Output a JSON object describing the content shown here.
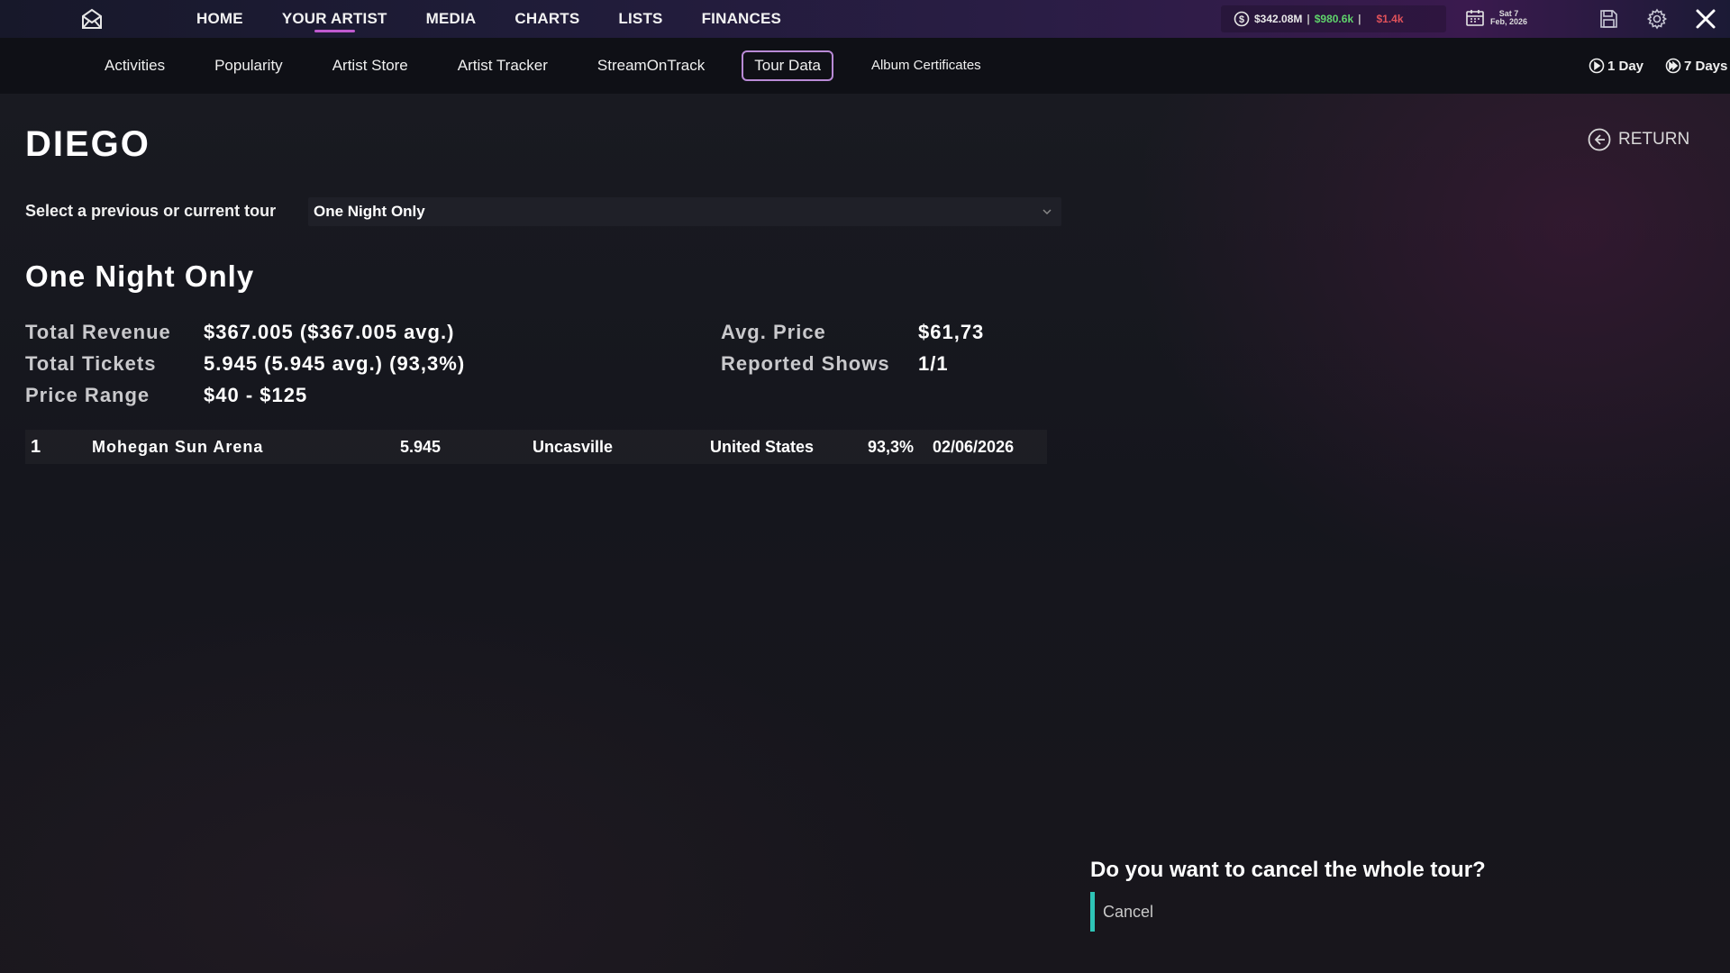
{
  "topnav": {
    "items": [
      "HOME",
      "YOUR ARTIST",
      "MEDIA",
      "CHARTS",
      "LISTS",
      "FINANCES"
    ],
    "active_index": 1
  },
  "finances": {
    "total": "$342.08M",
    "income": "$980.6k",
    "expense": "$1.4k"
  },
  "date": {
    "line1": "Sat 7",
    "line2": "Feb, 2026"
  },
  "subnav": {
    "items": [
      "Activities",
      "Popularity",
      "Artist Store",
      "Artist Tracker",
      "StreamOnTrack",
      "Tour Data",
      "Album Certificates"
    ],
    "active": "Tour Data"
  },
  "speed": {
    "one_day": "1 Day",
    "seven_days": "7 Days"
  },
  "return_label": "RETURN",
  "artist_name": "DIEGO",
  "tour_select": {
    "label": "Select a previous or current tour",
    "value": "One Night Only"
  },
  "tour": {
    "title": "One Night Only",
    "total_revenue_label": "Total Revenue",
    "total_revenue": "$367.005 ($367.005 avg.)",
    "total_tickets_label": "Total Tickets",
    "total_tickets": "5.945 (5.945 avg.) (93,3%)",
    "price_range_label": "Price Range",
    "price_range": "$40 - $125",
    "avg_price_label": "Avg. Price",
    "avg_price": "$61,73",
    "reported_shows_label": "Reported Shows",
    "reported_shows": "1/1"
  },
  "shows": [
    {
      "index": "1",
      "venue": "Mohegan Sun Arena",
      "tickets": "5.945",
      "city": "Uncasville",
      "country": "United States",
      "fill": "93,3%",
      "date": "02/06/2026"
    }
  ],
  "cancel": {
    "question": "Do you want to cancel the whole tour?",
    "button": "Cancel"
  },
  "colors": {
    "accent_purple": "#c05ad0",
    "cancel_accent": "#2ec4b6",
    "income": "#5fd36b",
    "expense": "#e0525a"
  }
}
